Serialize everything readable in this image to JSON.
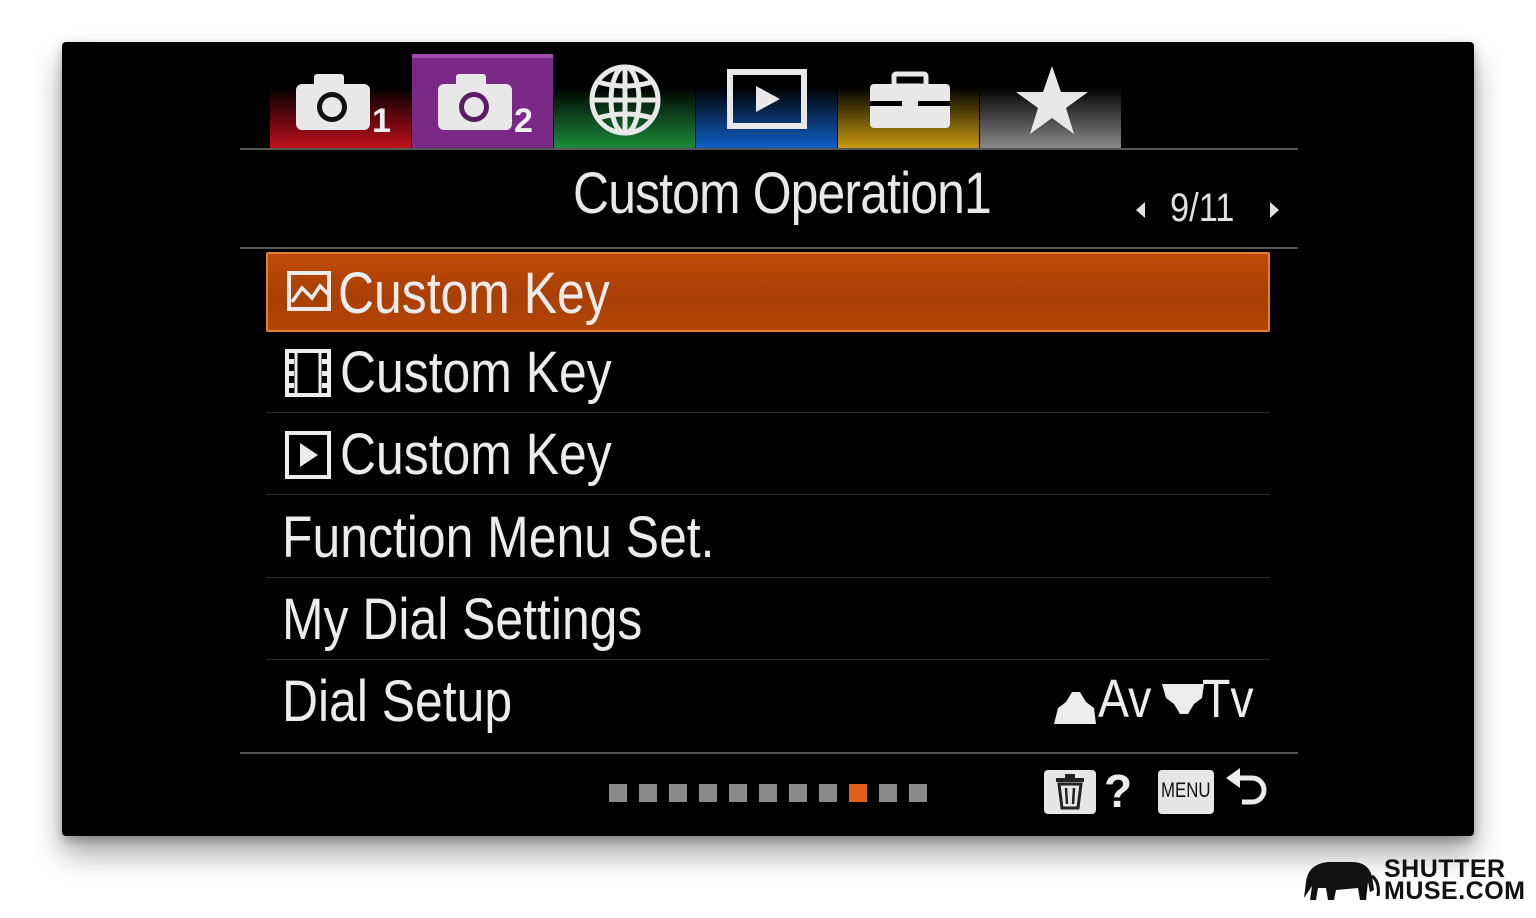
{
  "tabs": [
    {
      "name": "camera-settings-1",
      "number": "1",
      "color": "#c0101c",
      "active": false
    },
    {
      "name": "camera-settings-2",
      "number": "2",
      "color": "#7a2a86",
      "active": true
    },
    {
      "name": "network",
      "color": "#1b8c3a",
      "active": false
    },
    {
      "name": "playback",
      "color": "#1060c8",
      "active": false
    },
    {
      "name": "setup",
      "color": "#c89a10",
      "active": false
    },
    {
      "name": "my-menu",
      "color": "#8a8a8a",
      "active": false
    }
  ],
  "header": {
    "title": "Custom Operation1",
    "page": "9/11"
  },
  "menu": {
    "items": [
      {
        "label": "Custom Key",
        "icon": "still-image-icon",
        "selected": true
      },
      {
        "label": "Custom Key",
        "icon": "movie-icon",
        "selected": false
      },
      {
        "label": "Custom Key",
        "icon": "playback-icon",
        "selected": false
      },
      {
        "label": "Function Menu Set.",
        "selected": false
      },
      {
        "label": "My Dial Settings",
        "selected": false
      },
      {
        "label": "Dial Setup",
        "selected": false,
        "value_a": "Av",
        "value_b": "Tv"
      }
    ]
  },
  "pagination": {
    "total": 11,
    "current": 9
  },
  "footer": {
    "help": "?",
    "menu": "MENU"
  },
  "colors": {
    "selected": "#b34506",
    "selected_border": "#e0822f",
    "active_dot": "#e0601a"
  },
  "watermark": {
    "line1": "SHUTTER",
    "line2": "MUSE.COM"
  }
}
